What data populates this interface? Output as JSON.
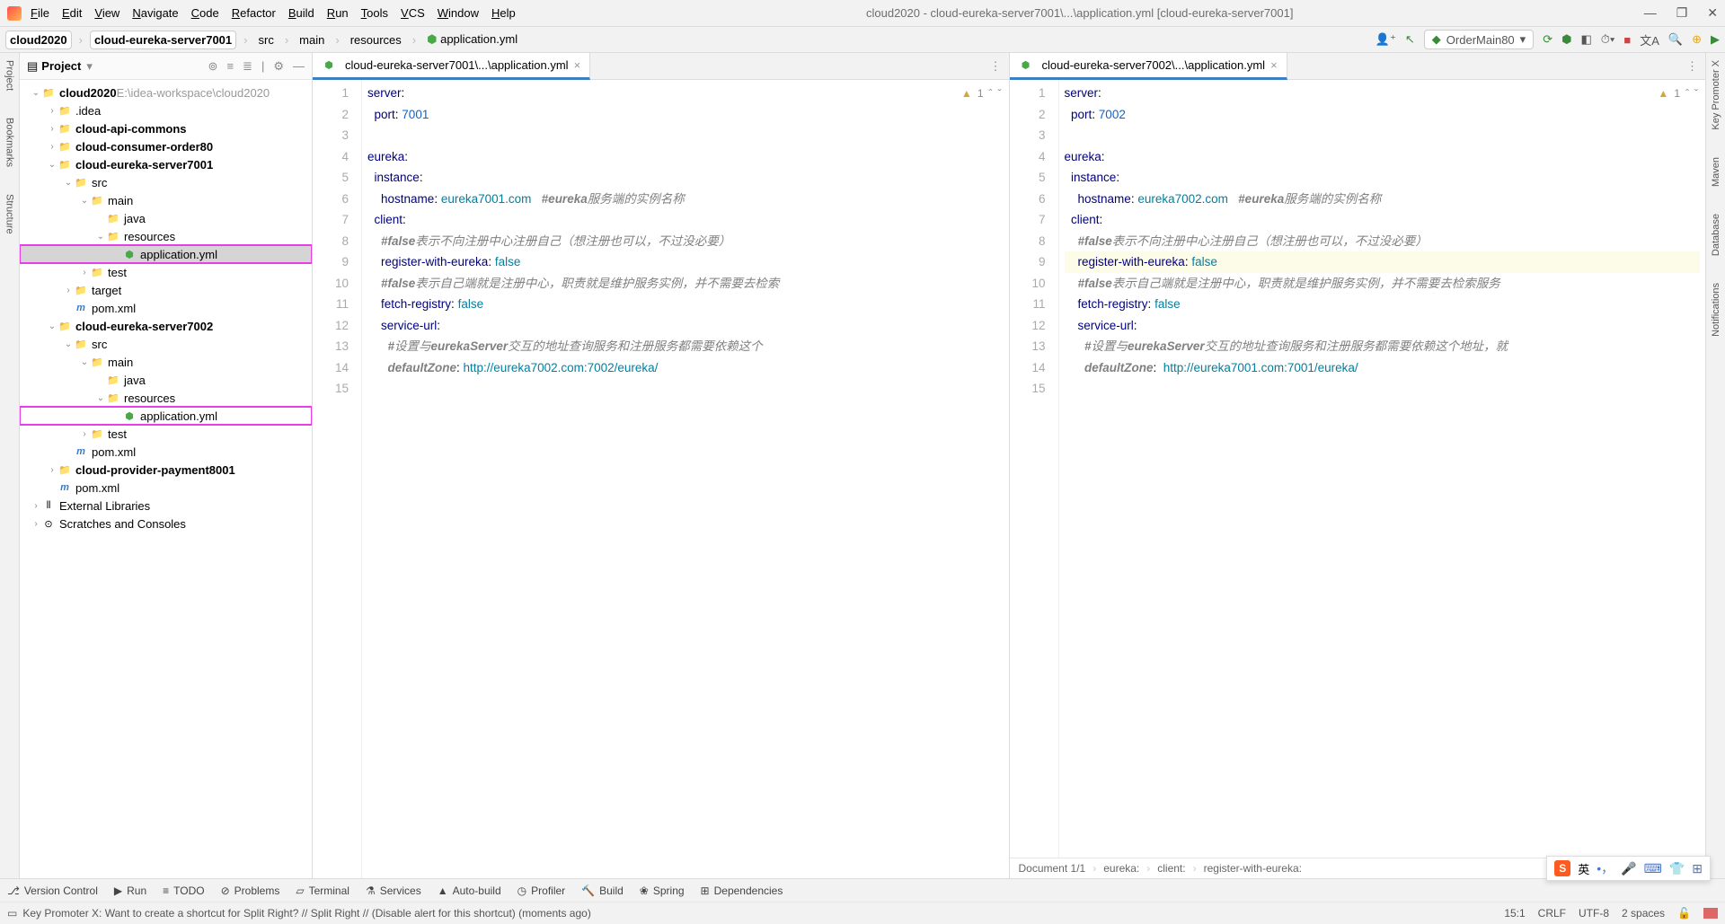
{
  "title": "cloud2020 - cloud-eureka-server7001\\...\\application.yml [cloud-eureka-server7001]",
  "menu": [
    "File",
    "Edit",
    "View",
    "Navigate",
    "Code",
    "Refactor",
    "Build",
    "Run",
    "Tools",
    "VCS",
    "Window",
    "Help"
  ],
  "crumbs": [
    "cloud2020",
    "cloud-eureka-server7001",
    "src",
    "main",
    "resources",
    "application.yml"
  ],
  "run_config": "OrderMain80",
  "leftstrip": [
    "Project",
    "Bookmarks",
    "Structure"
  ],
  "rightstrip": [
    "Key Promoter X",
    "Maven",
    "Database",
    "Notifications"
  ],
  "project": {
    "label": "Project"
  },
  "tree": [
    {
      "d": 0,
      "a": "v",
      "i": "folder-m",
      "t": "cloud2020",
      "suf": "E:\\idea-workspace\\cloud2020",
      "bold": true
    },
    {
      "d": 1,
      "a": ">",
      "i": "folder",
      "t": ".idea"
    },
    {
      "d": 1,
      "a": ">",
      "i": "folder-m",
      "t": "cloud-api-commons",
      "bold": true
    },
    {
      "d": 1,
      "a": ">",
      "i": "folder-m",
      "t": "cloud-consumer-order80",
      "bold": true
    },
    {
      "d": 1,
      "a": "v",
      "i": "folder-m",
      "t": "cloud-eureka-server7001",
      "bold": true
    },
    {
      "d": 2,
      "a": "v",
      "i": "folder",
      "t": "src"
    },
    {
      "d": 3,
      "a": "v",
      "i": "folder",
      "t": "main"
    },
    {
      "d": 4,
      "a": "",
      "i": "folder",
      "t": "java"
    },
    {
      "d": 4,
      "a": "v",
      "i": "folder",
      "t": "resources"
    },
    {
      "d": 5,
      "a": "",
      "i": "yml",
      "t": "application.yml",
      "sel": true,
      "hl": true
    },
    {
      "d": 3,
      "a": ">",
      "i": "folder",
      "t": "test"
    },
    {
      "d": 2,
      "a": ">",
      "i": "folder-o",
      "t": "target"
    },
    {
      "d": 2,
      "a": "",
      "i": "pom",
      "t": "pom.xml"
    },
    {
      "d": 1,
      "a": "v",
      "i": "folder-m",
      "t": "cloud-eureka-server7002",
      "bold": true
    },
    {
      "d": 2,
      "a": "v",
      "i": "folder",
      "t": "src"
    },
    {
      "d": 3,
      "a": "v",
      "i": "folder",
      "t": "main"
    },
    {
      "d": 4,
      "a": "",
      "i": "folder",
      "t": "java"
    },
    {
      "d": 4,
      "a": "v",
      "i": "folder",
      "t": "resources"
    },
    {
      "d": 5,
      "a": "",
      "i": "yml",
      "t": "application.yml",
      "hl": true
    },
    {
      "d": 3,
      "a": ">",
      "i": "folder",
      "t": "test"
    },
    {
      "d": 2,
      "a": "",
      "i": "pom",
      "t": "pom.xml"
    },
    {
      "d": 1,
      "a": ">",
      "i": "folder-m",
      "t": "cloud-provider-payment8001",
      "bold": true
    },
    {
      "d": 1,
      "a": "",
      "i": "pom",
      "t": "pom.xml"
    },
    {
      "d": 0,
      "a": ">",
      "i": "lib",
      "t": "External Libraries"
    },
    {
      "d": 0,
      "a": ">",
      "i": "scratch",
      "t": "Scratches and Consoles"
    }
  ],
  "editor_left": {
    "tab": "cloud-eureka-server7001\\...\\application.yml",
    "warn": "1",
    "lines": [
      [
        [
          "k",
          "server"
        ],
        [
          "p",
          ":"
        ]
      ],
      [
        [
          "p",
          "  "
        ],
        [
          "k",
          "port"
        ],
        [
          "p",
          ": "
        ],
        [
          "n",
          "7001"
        ]
      ],
      [],
      [
        [
          "k",
          "eureka"
        ],
        [
          "p",
          ":"
        ]
      ],
      [
        [
          "p",
          "  "
        ],
        [
          "k",
          "instance"
        ],
        [
          "p",
          ":"
        ]
      ],
      [
        [
          "p",
          "    "
        ],
        [
          "k",
          "hostname"
        ],
        [
          "p",
          ": "
        ],
        [
          "v",
          "eureka7001.com"
        ],
        [
          "p",
          "   "
        ],
        [
          "ci",
          "#eureka"
        ],
        [
          "c",
          "服务端的实例名称"
        ]
      ],
      [
        [
          "p",
          "  "
        ],
        [
          "k",
          "client"
        ],
        [
          "p",
          ":"
        ]
      ],
      [
        [
          "p",
          "    "
        ],
        [
          "ci",
          "#false"
        ],
        [
          "c",
          "表示不向注册中心注册自己（想注册也可以，不过没必要）"
        ]
      ],
      [
        [
          "p",
          "    "
        ],
        [
          "k",
          "register-with-eureka"
        ],
        [
          "p",
          ": "
        ],
        [
          "v",
          "false"
        ]
      ],
      [
        [
          "p",
          "    "
        ],
        [
          "ci",
          "#false"
        ],
        [
          "c",
          "表示自己端就是注册中心，职责就是维护服务实例，并不需要去检索"
        ]
      ],
      [
        [
          "p",
          "    "
        ],
        [
          "k",
          "fetch-registry"
        ],
        [
          "p",
          ": "
        ],
        [
          "v",
          "false"
        ]
      ],
      [
        [
          "p",
          "    "
        ],
        [
          "k",
          "service-url"
        ],
        [
          "p",
          ":"
        ]
      ],
      [
        [
          "p",
          "      "
        ],
        [
          "ci",
          "#"
        ],
        [
          "c",
          "设置与"
        ],
        [
          "ci",
          "eurekaServer"
        ],
        [
          "c",
          "交互的地址查询服务和注册服务都需要依赖这个"
        ]
      ],
      [
        [
          "p",
          "      "
        ],
        [
          "ci",
          "defaultZone"
        ],
        [
          "p",
          ": "
        ],
        [
          "v",
          "http://eureka7002.com:7002/eureka/"
        ]
      ],
      []
    ]
  },
  "editor_right": {
    "tab": "cloud-eureka-server7002\\...\\application.yml",
    "warn": "1",
    "hl_line": 9,
    "lines": [
      [
        [
          "k",
          "server"
        ],
        [
          "p",
          ":"
        ]
      ],
      [
        [
          "p",
          "  "
        ],
        [
          "k",
          "port"
        ],
        [
          "p",
          ": "
        ],
        [
          "n",
          "7002"
        ]
      ],
      [],
      [
        [
          "k",
          "eureka"
        ],
        [
          "p",
          ":"
        ]
      ],
      [
        [
          "p",
          "  "
        ],
        [
          "k",
          "instance"
        ],
        [
          "p",
          ":"
        ]
      ],
      [
        [
          "p",
          "    "
        ],
        [
          "k",
          "hostname"
        ],
        [
          "p",
          ": "
        ],
        [
          "v",
          "eureka7002.com"
        ],
        [
          "p",
          "   "
        ],
        [
          "ci",
          "#eureka"
        ],
        [
          "c",
          "服务端的实例名称"
        ]
      ],
      [
        [
          "p",
          "  "
        ],
        [
          "k",
          "client"
        ],
        [
          "p",
          ":"
        ]
      ],
      [
        [
          "p",
          "    "
        ],
        [
          "ci",
          "#false"
        ],
        [
          "c",
          "表示不向注册中心注册自己（想注册也可以，不过没必要）"
        ]
      ],
      [
        [
          "p",
          "    "
        ],
        [
          "k",
          "register-with-eureka"
        ],
        [
          "p",
          ": "
        ],
        [
          "v",
          "false"
        ]
      ],
      [
        [
          "p",
          "    "
        ],
        [
          "ci",
          "#false"
        ],
        [
          "c",
          "表示自己端就是注册中心，职责就是维护服务实例，并不需要去检索服务"
        ]
      ],
      [
        [
          "p",
          "    "
        ],
        [
          "k",
          "fetch-registry"
        ],
        [
          "p",
          ": "
        ],
        [
          "v",
          "false"
        ]
      ],
      [
        [
          "p",
          "    "
        ],
        [
          "k",
          "service-url"
        ],
        [
          "p",
          ":"
        ]
      ],
      [
        [
          "p",
          "      "
        ],
        [
          "ci",
          "#"
        ],
        [
          "c",
          "设置与"
        ],
        [
          "ci",
          "eurekaServer"
        ],
        [
          "c",
          "交互的地址查询服务和注册服务都需要依赖这个地址，就"
        ]
      ],
      [
        [
          "p",
          "      "
        ],
        [
          "ci",
          "defaultZone"
        ],
        [
          "p",
          ":  "
        ],
        [
          "v",
          "http://eureka7001.com:7001/eureka/"
        ]
      ],
      []
    ],
    "breadcrumb": [
      "Document 1/1",
      "eureka:",
      "client:",
      "register-with-eureka:"
    ]
  },
  "bottom": [
    "Version Control",
    "Run",
    "TODO",
    "Problems",
    "Terminal",
    "Services",
    "Auto-build",
    "Profiler",
    "Build",
    "Spring",
    "Dependencies"
  ],
  "status": {
    "msg": "Key Promoter X: Want to create a shortcut for Split Right? // Split Right // (Disable alert for this shortcut) (moments ago)",
    "pos": "15:1",
    "sep": "CRLF",
    "enc": "UTF-8",
    "indent": "2 spaces"
  },
  "ime": "英"
}
